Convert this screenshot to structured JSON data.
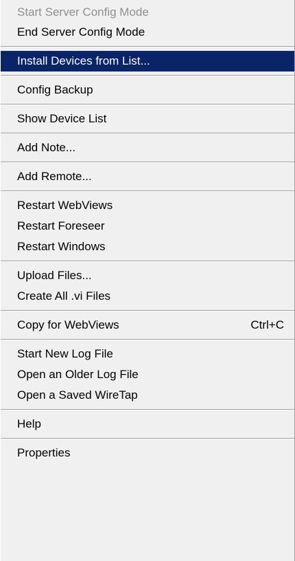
{
  "menu": {
    "groups": [
      {
        "items": [
          {
            "label": "Start Server Config Mode",
            "disabled": true
          },
          {
            "label": "End Server Config Mode"
          }
        ]
      },
      {
        "items": [
          {
            "label": "Install Devices from List...",
            "selected": true
          }
        ]
      },
      {
        "items": [
          {
            "label": "Config Backup"
          }
        ]
      },
      {
        "items": [
          {
            "label": "Show Device List"
          }
        ]
      },
      {
        "items": [
          {
            "label": "Add Note..."
          }
        ]
      },
      {
        "items": [
          {
            "label": "Add Remote..."
          }
        ]
      },
      {
        "items": [
          {
            "label": "Restart WebViews"
          },
          {
            "label": "Restart Foreseer"
          },
          {
            "label": "Restart Windows"
          }
        ]
      },
      {
        "items": [
          {
            "label": "Upload Files..."
          },
          {
            "label": "Create All .vi Files"
          }
        ]
      },
      {
        "items": [
          {
            "label": "Copy for WebViews",
            "shortcut": "Ctrl+C"
          }
        ]
      },
      {
        "items": [
          {
            "label": "Start New Log File"
          },
          {
            "label": "Open an Older Log File"
          },
          {
            "label": "Open a Saved WireTap"
          }
        ]
      },
      {
        "items": [
          {
            "label": "Help"
          }
        ]
      },
      {
        "items": [
          {
            "label": "Properties"
          }
        ]
      }
    ]
  },
  "colors": {
    "menu_background": "#f0f0f0",
    "selected_background": "#0a246a",
    "selected_text": "#ffffff",
    "disabled_text": "#8f8f8f"
  }
}
